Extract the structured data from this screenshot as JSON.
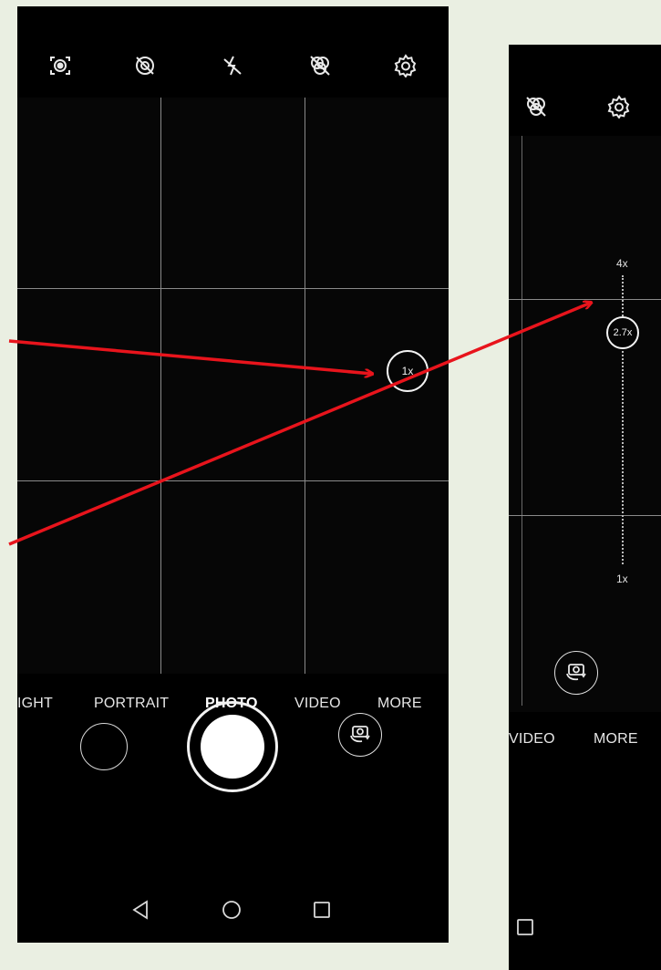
{
  "left_phone": {
    "top_icons": [
      "smart-capture-icon",
      "ai-off-icon",
      "flash-off-icon",
      "filter-off-icon",
      "settings-gear-icon"
    ],
    "zoom_label": "1x",
    "modes": [
      {
        "label": "IGHT",
        "active": false
      },
      {
        "label": "PORTRAIT",
        "active": false
      },
      {
        "label": "PHOTO",
        "active": true
      },
      {
        "label": "VIDEO",
        "active": false
      },
      {
        "label": "MORE",
        "active": false
      }
    ],
    "nav": [
      "back-triangle-icon",
      "home-circle-icon",
      "recents-square-icon"
    ]
  },
  "right_phone": {
    "top_icons": [
      "filter-off-icon",
      "settings-gear-icon"
    ],
    "zoom_slider": {
      "max_label": "4x",
      "current_label": "2.7x",
      "min_label": "1x",
      "current_value": 2.7
    },
    "modes": [
      {
        "label": "VIDEO",
        "active": false
      },
      {
        "label": "MORE",
        "active": false
      }
    ],
    "nav": [
      "recents-square-icon"
    ]
  },
  "annotation": {
    "arrow_color": "#e8141c"
  },
  "colors": {
    "background": "#eaefe2",
    "mode_indicator": "#1e6fe0"
  }
}
